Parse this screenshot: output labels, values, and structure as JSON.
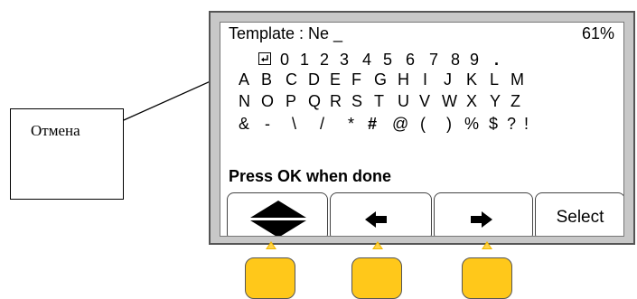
{
  "callout": {
    "label": "Отмена"
  },
  "screen": {
    "title": "Template : Ne _",
    "battery": "61%",
    "keyboard": {
      "enter_key": "enter-return-icon",
      "row0": [
        "0",
        "1",
        "2",
        "3",
        "4",
        "5",
        "6",
        "7",
        "8",
        "9",
        "."
      ],
      "row1": [
        "A",
        "B",
        "C",
        "D",
        "E",
        "F",
        "G",
        "H",
        "I",
        "J",
        "K",
        "L",
        "M"
      ],
      "row2": [
        "N",
        "O",
        "P",
        "Q",
        "R",
        "S",
        "T",
        "U",
        "V",
        "W",
        "X",
        "Y",
        "Z"
      ],
      "row3": [
        "&",
        "-",
        "\\",
        "/",
        "*",
        "#",
        "@",
        "(",
        ")",
        "%",
        "$",
        "?",
        "!"
      ]
    },
    "prompt": "Press OK when done",
    "softkeys": {
      "updown_icon": "up-down-icon",
      "left_icon": "left-arrow-icon",
      "right_icon": "right-arrow-icon",
      "select_label": "Select"
    }
  },
  "colors": {
    "button_fill": "#ffc81a",
    "device_frame": "#c8c8c8",
    "device_border": "#555555"
  }
}
